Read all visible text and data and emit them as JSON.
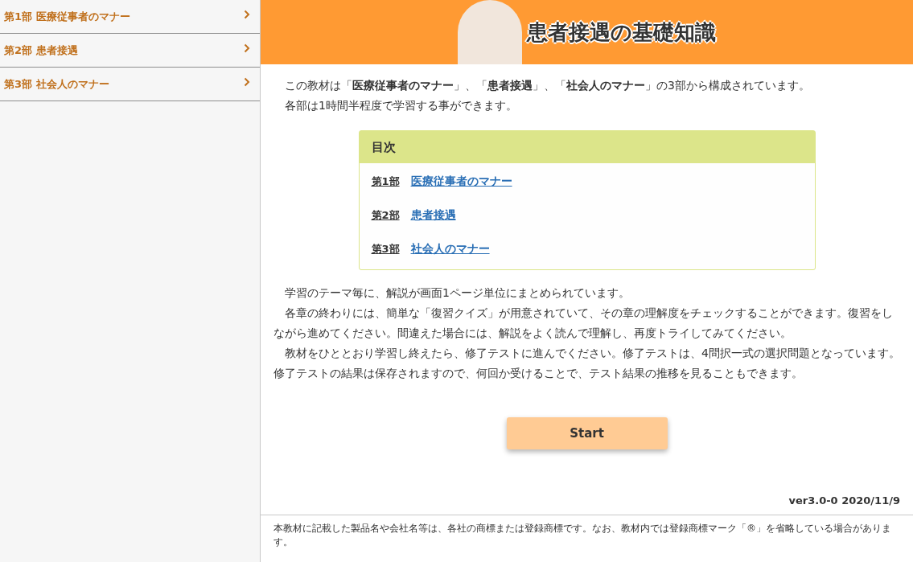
{
  "sidebar": {
    "items": [
      {
        "label": "第1部 医療従事者のマナー"
      },
      {
        "label": "第2部 患者接遇"
      },
      {
        "label": "第3部 社会人のマナー"
      }
    ]
  },
  "banner": {
    "title": "患者接遇の基礎知識"
  },
  "intro": [
    "この教材は「**医療従事者のマナー**」、「**患者接遇**」、「**社会人のマナー**」の3部から構成されています。",
    "各部は1時間半程度で学習する事ができます。"
  ],
  "toc": {
    "title": "目次",
    "items": [
      {
        "part": "第1部",
        "title": "医療従事者のマナー"
      },
      {
        "part": "第2部",
        "title": "患者接遇"
      },
      {
        "part": "第3部",
        "title": "社会人のマナー"
      }
    ]
  },
  "paragraphs": [
    "学習のテーマ毎に、解説が画面1ページ単位にまとめられています。",
    "各章の終わりには、簡単な「復習クイズ」が用意されていて、その章の理解度をチェックすることができます。復習をしながら進めてください。間違えた場合には、解説をよく読んで理解し、再度トライしてみてください。",
    "教材をひととおり学習し終えたら、修了テストに進んでください。修了テストは、4問択一式の選択問題となっています。修了テストの結果は保存されますので、何回か受けることで、テスト結果の推移を見ることもできます。"
  ],
  "start_button": "Start",
  "version": "ver3.0-0 2020/11/9",
  "footer_note": "本教材に記載した製品名や会社名等は、各社の商標または登録商標です。なお、教材内では登録商標マーク「®」を省略している場合があります。"
}
